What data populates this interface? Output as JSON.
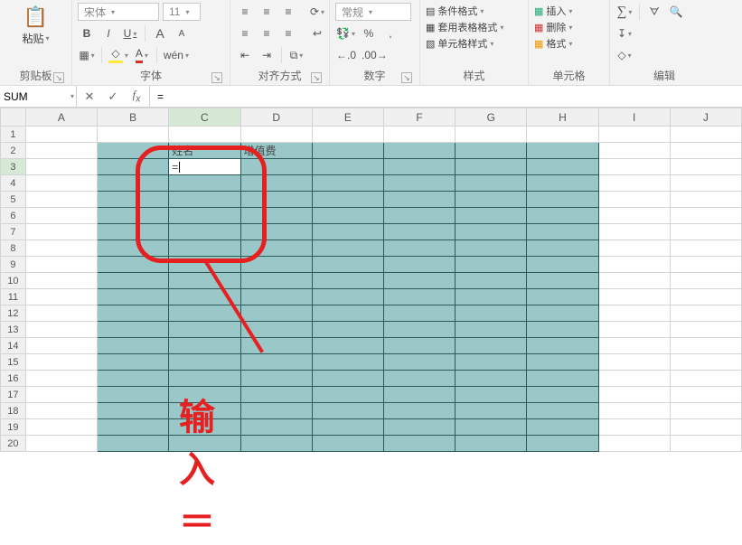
{
  "ribbon": {
    "clipboard": {
      "paste": "粘贴",
      "label": "剪贴板"
    },
    "font": {
      "fontName": "宋体",
      "fontSize": "11",
      "ruby": "wén",
      "label": "字体",
      "b": "B",
      "i": "I",
      "u": "U",
      "aUp": "A",
      "aDown": "A"
    },
    "align": {
      "label": "对齐方式",
      "wrap": "",
      "merge": ""
    },
    "number": {
      "combo": "常规",
      "pct": "%",
      "comma": ",",
      "inc": ".0",
      "dec": ".00",
      "label": "数字"
    },
    "styles": {
      "cond": "条件格式",
      "tbl": "套用表格格式",
      "cell": "单元格样式",
      "label": "样式"
    },
    "cells": {
      "ins": "插入",
      "del": "删除",
      "fmt": "格式",
      "label": "单元格"
    },
    "editing": {
      "sigma": "∑",
      "fill": "",
      "clear": "",
      "label": "编辑"
    }
  },
  "formulaBar": {
    "name": "SUM",
    "value": "="
  },
  "columns": [
    "A",
    "B",
    "C",
    "D",
    "E",
    "F",
    "G",
    "H",
    "I",
    "J"
  ],
  "rows": 20,
  "activeCol": "C",
  "activeRow": 3,
  "cells": {
    "C2": "姓名",
    "D2": "增值费",
    "C3": "="
  },
  "annotation": {
    "text": "输入＝"
  }
}
